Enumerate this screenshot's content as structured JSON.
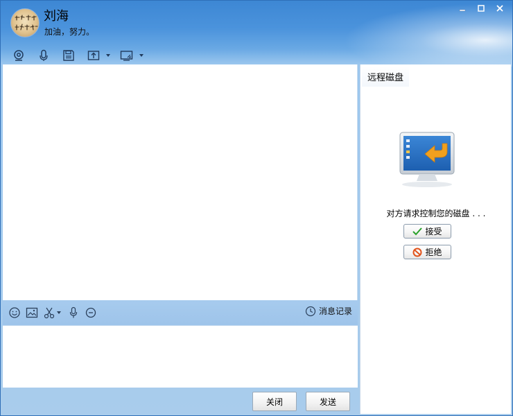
{
  "header": {
    "contact_name": "刘海",
    "status": "加油，努力。"
  },
  "toolbar": {
    "icons": [
      "webcam-icon",
      "microphone-icon",
      "save-icon",
      "share-screen-icon",
      "remote-desktop-icon"
    ]
  },
  "input_toolbar": {
    "history_label": "消息记录"
  },
  "footer": {
    "close_label": "关闭",
    "send_label": "发送"
  },
  "side_panel": {
    "tab_label": "远程磁盘",
    "request_text": "对方请求控制您的磁盘 . . .",
    "accept_label": "接受",
    "reject_label": "拒绝"
  },
  "colors": {
    "header_blue": "#3d87d4",
    "toolbar_blue": "#a7cbee",
    "accent_orange": "#f0a01e"
  }
}
